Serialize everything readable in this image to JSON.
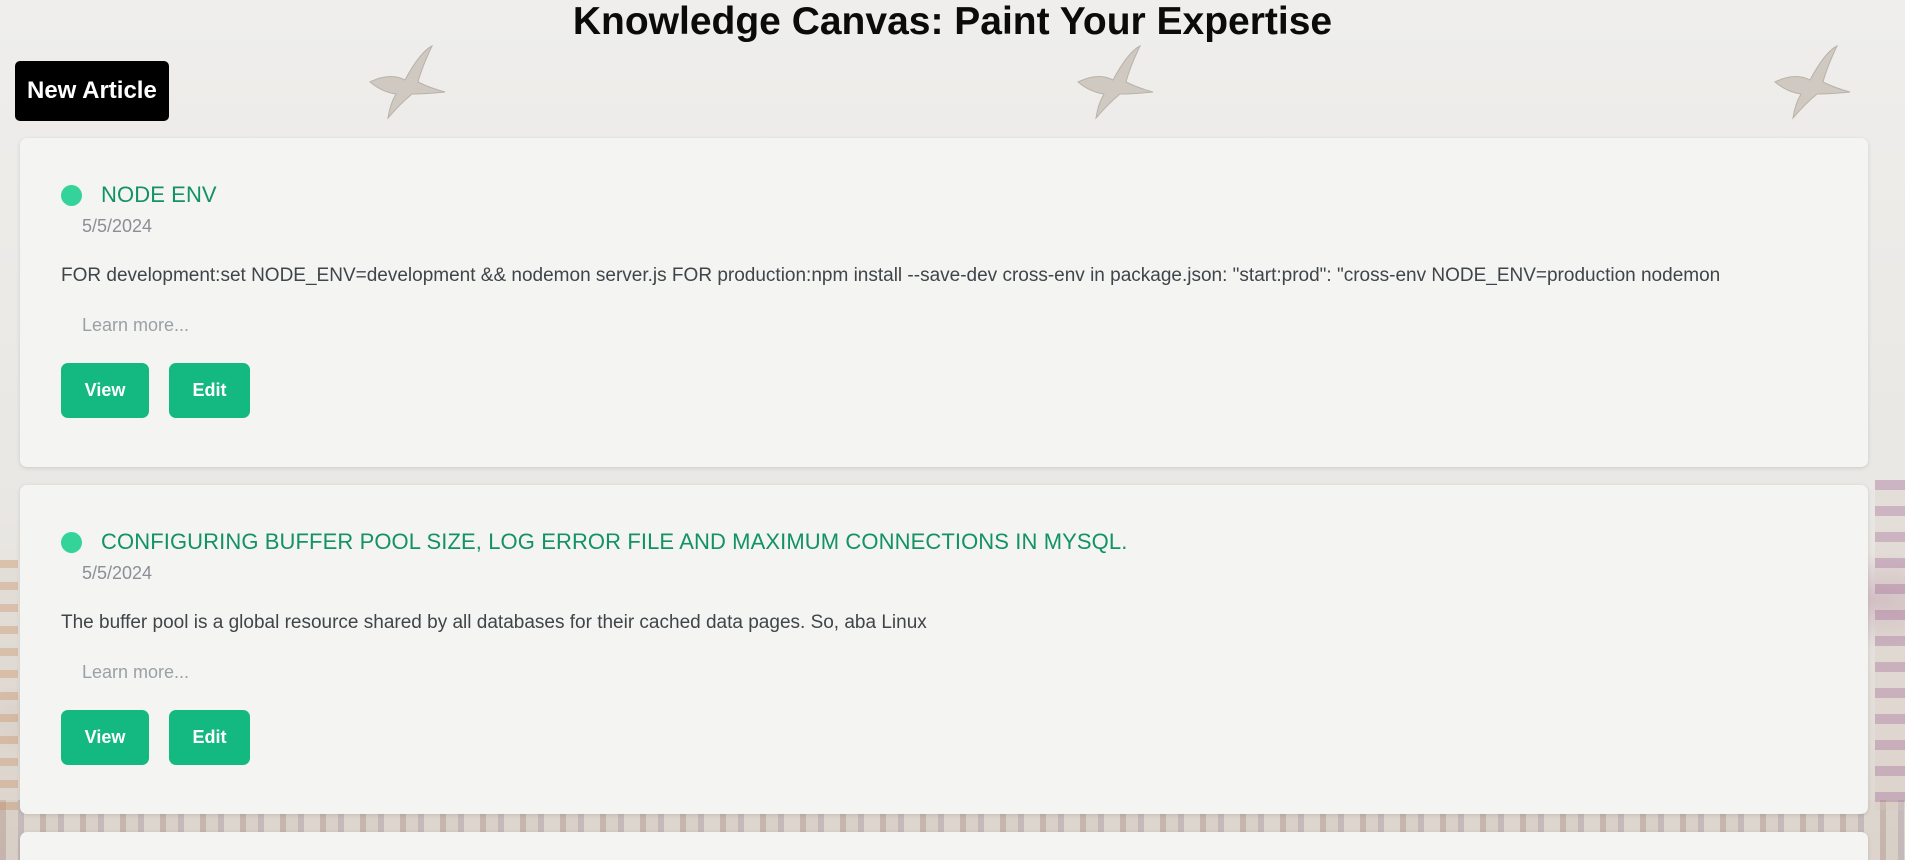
{
  "page": {
    "title": "Knowledge Canvas: Paint Your Expertise",
    "new_article_label": "New Article"
  },
  "colors": {
    "accent": "#13b981",
    "title_green": "#129265",
    "dot_green": "#34d399",
    "card_bg": "#f4f4f2"
  },
  "articles": [
    {
      "title": "NODE ENV",
      "date": "5/5/2024",
      "excerpt": "FOR development:set NODE_ENV=development && nodemon server.js FOR production:npm install --save-dev cross-env in package.json: \"start:prod\": \"cross-env NODE_ENV=production nodemon",
      "learn_more": "Learn more...",
      "view_label": "View",
      "edit_label": "Edit"
    },
    {
      "title": "CONFIGURING BUFFER POOL SIZE, LOG ERROR FILE AND MAXIMUM CONNECTIONS IN MYSQL.",
      "date": "5/5/2024",
      "excerpt": "The buffer pool is a global resource shared by all databases for their cached data pages. So, aba Linux",
      "learn_more": "Learn more...",
      "view_label": "View",
      "edit_label": "Edit"
    }
  ]
}
